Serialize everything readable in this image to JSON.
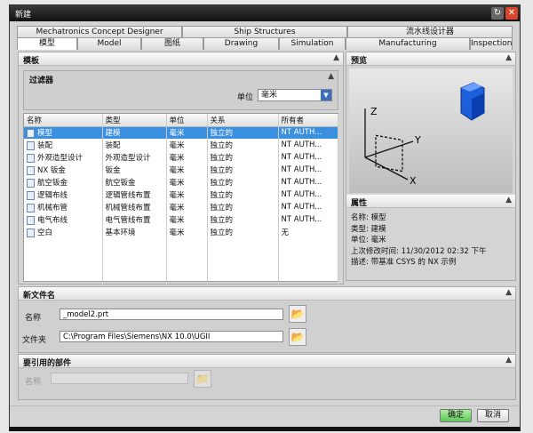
{
  "title": "新建",
  "tabs_row1": [
    "Mechatronics Concept Designer",
    "Ship Structures",
    "流水线设计器"
  ],
  "tabs_row2": [
    "模型",
    "Model",
    "图纸",
    "Drawing",
    "Simulation",
    "Manufacturing",
    "Inspection"
  ],
  "templates": {
    "header": "模板",
    "filter_header": "过滤器",
    "unit_label": "单位",
    "unit_value": "毫米",
    "columns": [
      "名称",
      "类型",
      "单位",
      "关系",
      "所有者"
    ],
    "rows": [
      [
        "模型",
        "建模",
        "毫米",
        "独立的",
        "NT AUTH..."
      ],
      [
        "装配",
        "装配",
        "毫米",
        "独立的",
        "NT AUTH..."
      ],
      [
        "外观造型设计",
        "外观造型设计",
        "毫米",
        "独立的",
        "NT AUTH..."
      ],
      [
        "NX 钣金",
        "钣金",
        "毫米",
        "独立的",
        "NT AUTH..."
      ],
      [
        "航空钣金",
        "航空钣金",
        "毫米",
        "独立的",
        "NT AUTH..."
      ],
      [
        "逻辑布线",
        "逻辑管线布置",
        "毫米",
        "独立的",
        "NT AUTH..."
      ],
      [
        "机械布管",
        "机械管线布置",
        "毫米",
        "独立的",
        "NT AUTH..."
      ],
      [
        "电气布线",
        "电气管线布置",
        "毫米",
        "独立的",
        "NT AUTH..."
      ],
      [
        "空白",
        "基本环境",
        "毫米",
        "独立的",
        "无"
      ]
    ]
  },
  "preview": {
    "header": "预览",
    "axes": [
      "Z",
      "Y",
      "X"
    ]
  },
  "properties": {
    "header": "属性",
    "lines": [
      "名称:  模型",
      "类型:  建模",
      "单位:  毫米",
      "上次修改时间:  11/30/2012 02:32 下午",
      "描述:  带基准 CSYS 的 NX 示例"
    ]
  },
  "new_file": {
    "header": "新文件名",
    "name_label": "名称",
    "name_value": "_model2.prt",
    "folder_label": "文件夹",
    "folder_value": "C:\\Program Files\\Siemens\\NX 10.0\\UGII"
  },
  "ref_parts": {
    "header": "要引用的部件",
    "name_label": "名称",
    "name_value": ""
  },
  "buttons": {
    "ok": "确定",
    "cancel": "取消"
  }
}
